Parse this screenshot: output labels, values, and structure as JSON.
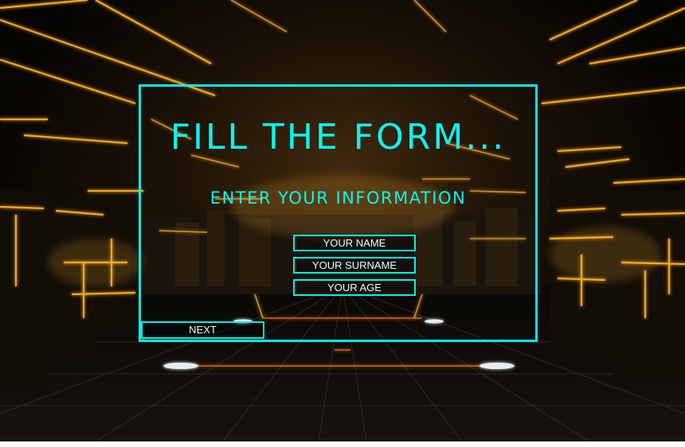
{
  "form": {
    "title": "FILL THE FORM...",
    "subtitle": "ENTER YOUR INFORMATION",
    "fields": {
      "name_placeholder": "YOUR NAME",
      "surname_placeholder": "YOUR SURNAME",
      "age_placeholder": "YOUR AGE"
    },
    "next_label": "NEXT"
  },
  "colors": {
    "accent": "#00f2ea",
    "background": "#050403",
    "glow": "#f5a623"
  }
}
